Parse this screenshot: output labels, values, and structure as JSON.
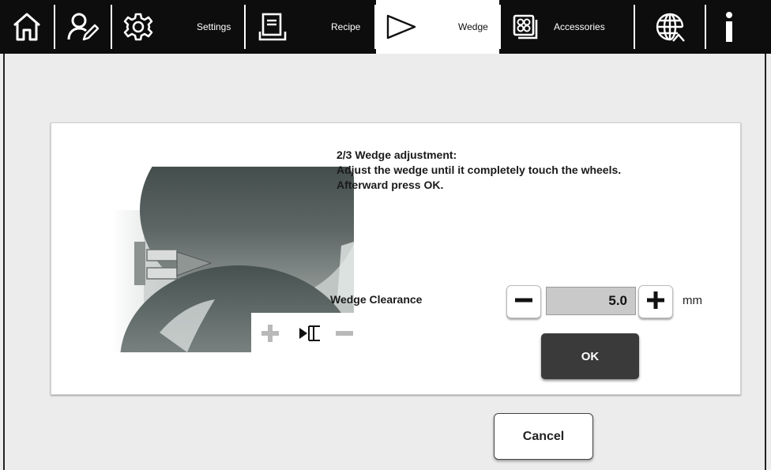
{
  "toolbar": {
    "items": [
      {
        "name": "home",
        "icon": "home-icon",
        "label": ""
      },
      {
        "name": "user",
        "icon": "user-edit-icon",
        "label": ""
      },
      {
        "name": "settings",
        "icon": "gear-icon",
        "label": "Settings"
      },
      {
        "name": "recipe",
        "icon": "recipe-icon",
        "label": "Recipe"
      },
      {
        "name": "wedge",
        "icon": "wedge-icon",
        "label": "Wedge",
        "active": true
      },
      {
        "name": "accessories",
        "icon": "accessories-icon",
        "label": "Accessories"
      },
      {
        "name": "language",
        "icon": "globe-icon",
        "label": ""
      },
      {
        "name": "info",
        "icon": "info-icon",
        "label": ""
      }
    ],
    "colors": {
      "background": "#0d0d0d",
      "icon": "#ffffff",
      "active_background": "#ffffff"
    }
  },
  "dialog": {
    "instructions": [
      "2/3 Wedge adjustment:",
      "Adjust the wedge until it completely touch the wheels.",
      "Afterward press OK."
    ],
    "image_icons": [
      "plus-icon",
      "wedge-position-icon",
      "minus-icon"
    ],
    "clearance": {
      "label": "Wedge Clearance",
      "value": "5.0",
      "unit": "mm",
      "decrement_icon": "minus-icon",
      "increment_icon": "plus-icon"
    },
    "ok_label": "OK"
  },
  "cancel_label": "Cancel"
}
